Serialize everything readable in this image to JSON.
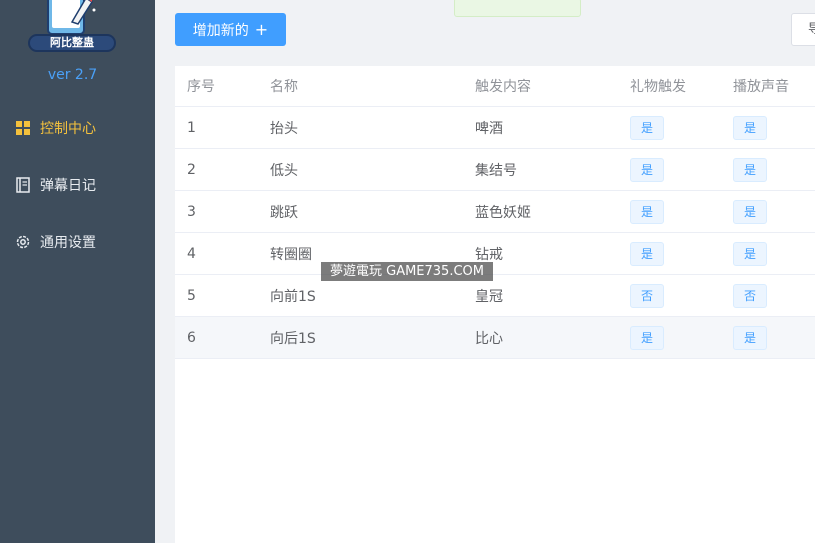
{
  "sidebar": {
    "logo_text": "阿比整蛊",
    "version": "ver 2.7",
    "items": [
      {
        "label": "控制中心",
        "icon": "grid-icon",
        "active": true
      },
      {
        "label": "弹幕日记",
        "icon": "notebook-icon",
        "active": false
      },
      {
        "label": "通用设置",
        "icon": "gear-icon",
        "active": false
      }
    ]
  },
  "toolbar": {
    "add_label": "增加新的",
    "add_icon": "+",
    "right_label": "导"
  },
  "table": {
    "headers": [
      "序号",
      "名称",
      "触发内容",
      "礼物触发",
      "播放声音"
    ],
    "rows": [
      {
        "id": "1",
        "name": "抬头",
        "content": "啤酒",
        "gift": "是",
        "sound": "是"
      },
      {
        "id": "2",
        "name": "低头",
        "content": "集结号",
        "gift": "是",
        "sound": "是"
      },
      {
        "id": "3",
        "name": "跳跃",
        "content": "蓝色妖姬",
        "gift": "是",
        "sound": "是"
      },
      {
        "id": "4",
        "name": "转圈圈",
        "content": "钻戒",
        "gift": "是",
        "sound": "是"
      },
      {
        "id": "5",
        "name": "向前1S",
        "content": "皇冠",
        "gift": "否",
        "sound": "否"
      },
      {
        "id": "6",
        "name": "向后1S",
        "content": "比心",
        "gift": "是",
        "sound": "是"
      }
    ]
  },
  "watermark": "夢遊電玩 GAME735.COM",
  "colors": {
    "sidebar_bg": "#3e4d5c",
    "accent": "#409eff",
    "active_menu": "#f4c13d"
  }
}
